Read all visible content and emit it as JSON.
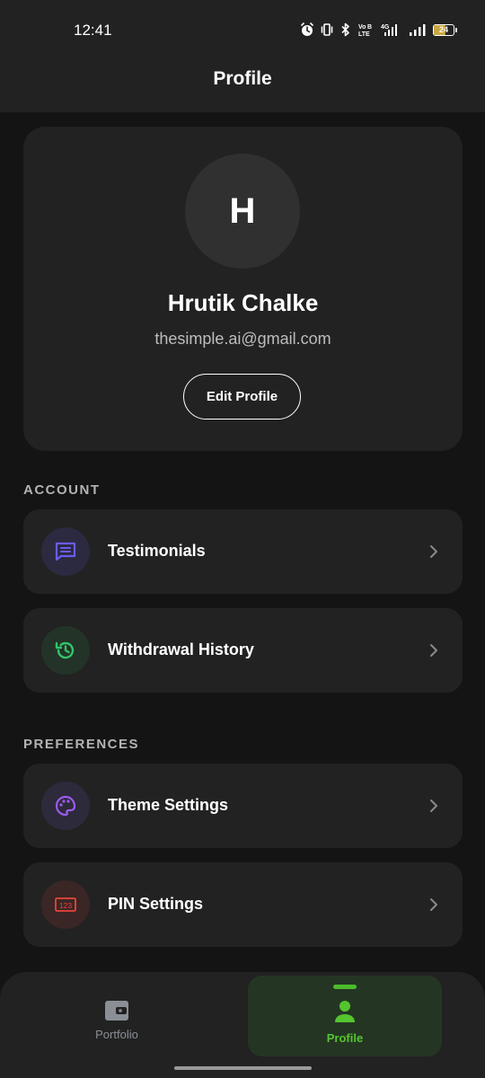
{
  "status_bar": {
    "time": "12:41",
    "network": "4G",
    "battery": "24",
    "icons": [
      "alarm-icon",
      "vibrate-icon",
      "bluetooth-icon",
      "volte-icon",
      "signal-4g-icon",
      "signal-icon",
      "battery-icon"
    ]
  },
  "header": {
    "title": "Profile"
  },
  "profile": {
    "avatar_initial": "H",
    "name": "Hrutik Chalke",
    "email": "thesimple.ai@gmail.com",
    "edit_label": "Edit Profile"
  },
  "sections": {
    "account": {
      "title": "ACCOUNT",
      "items": [
        {
          "label": "Testimonials",
          "icon": "chat-message-icon",
          "icon_color": "#6a5cf0",
          "icon_bg": "#2b2a40"
        },
        {
          "label": "Withdrawal History",
          "icon": "history-icon",
          "icon_color": "#33c46a",
          "icon_bg": "#233328"
        }
      ]
    },
    "preferences": {
      "title": "PREFERENCES",
      "items": [
        {
          "label": "Theme Settings",
          "icon": "palette-icon",
          "icon_color": "#9b5cf0",
          "icon_bg": "#2d2a3b"
        },
        {
          "label": "PIN Settings",
          "icon": "pin-123-icon",
          "icon_color": "#e8453b",
          "icon_bg": "#3a2625"
        }
      ]
    }
  },
  "bottom_nav": {
    "items": [
      {
        "label": "Portfolio",
        "icon": "wallet-icon",
        "active": false
      },
      {
        "label": "Profile",
        "icon": "person-icon",
        "active": true
      }
    ],
    "active_color": "#4cbb2c"
  }
}
